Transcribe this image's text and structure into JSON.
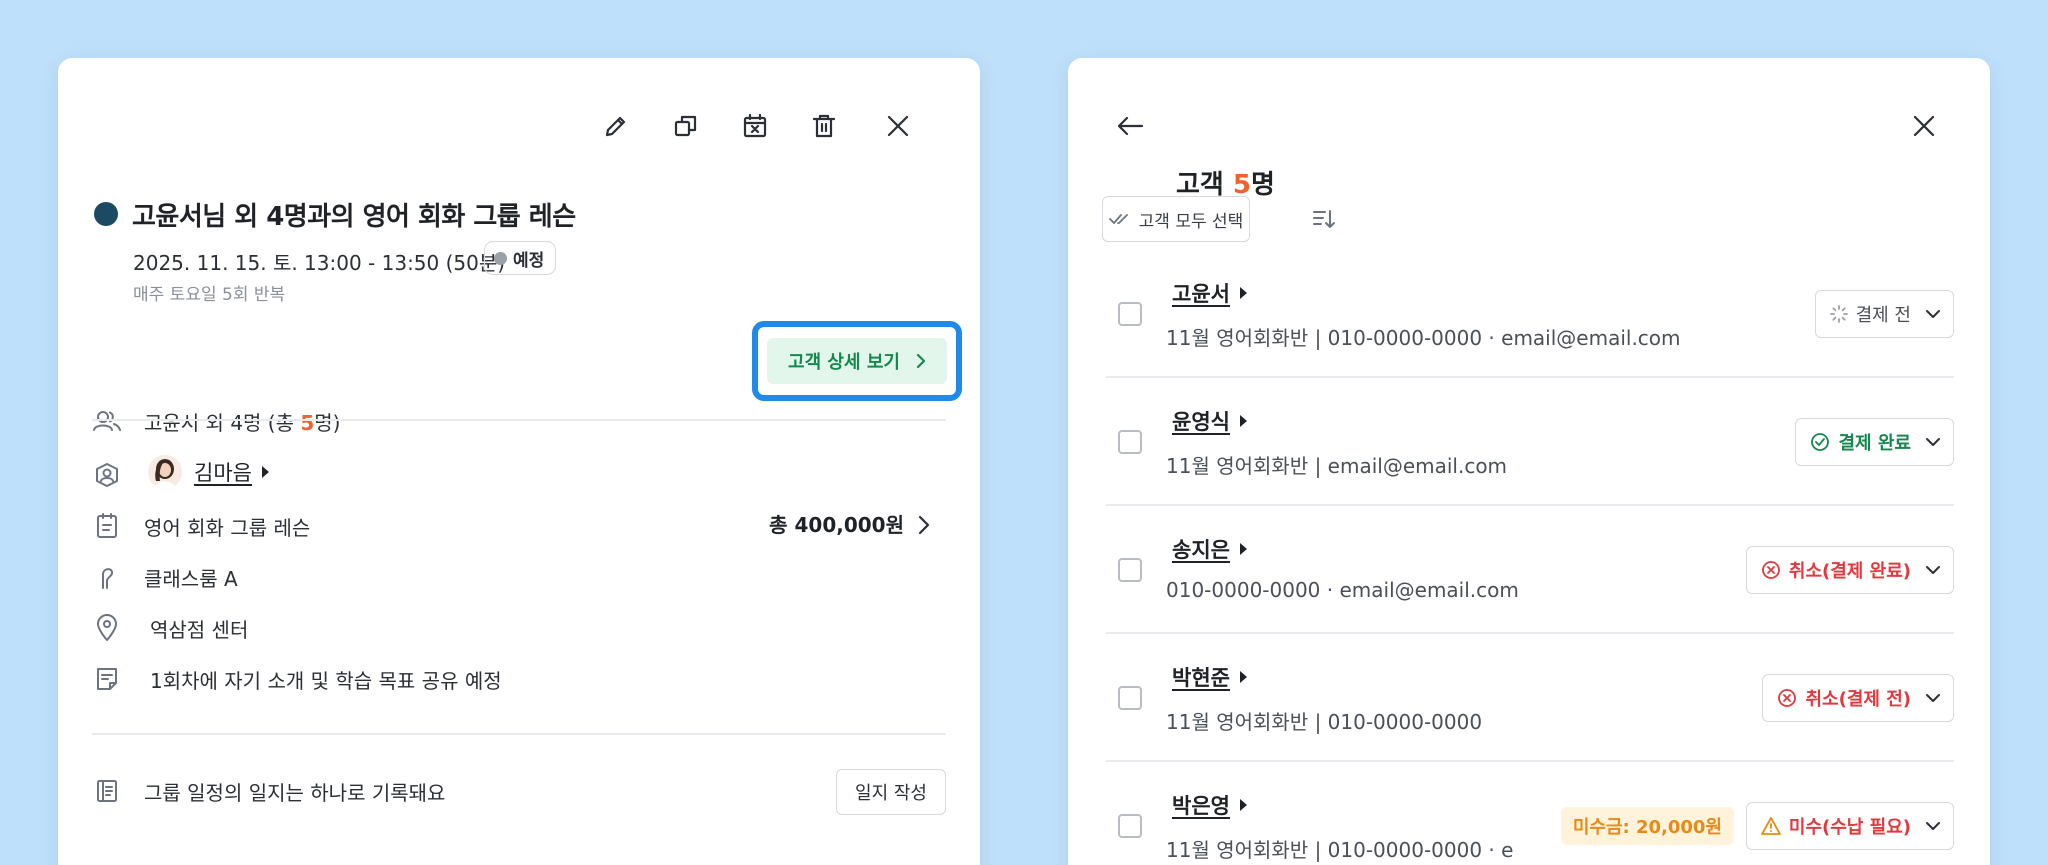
{
  "event": {
    "title": "고윤서님 외 4명과의 영어 회화 그룹 레슨",
    "datetime": "2025. 11. 15. 토. 13:00 - 13:50 (50분)",
    "status": "예정",
    "repeat": "매주 토요일 5회 반복",
    "attendees_prefix": "고윤서 외 4명 (총 ",
    "attendees_count": "5",
    "attendees_suffix": "명)",
    "detail_button": "고객 상세 보기",
    "teacher_name": "김마음",
    "course_name": "영어 회화 그룹 레슨",
    "price": "총 400,000원",
    "classroom": "클래스룸 A",
    "location": "역삼점 센터",
    "memo": "1회차에 자기 소개 및 학습 목표 공유 예정",
    "journal_note": "그룹 일정의 일지는 하나로 기록돼요",
    "journal_button": "일지 작성"
  },
  "customers_panel": {
    "title_prefix": "고객 ",
    "title_count": "5",
    "title_suffix": "명",
    "select_all": "고객 모두 선택",
    "customers": [
      {
        "name": "고윤서",
        "info": "11월 영어회화반 | 010-0000-0000 · email@email.com",
        "status": "결제 전",
        "status_color": "#4a4f58"
      },
      {
        "name": "윤영식",
        "info": "11월 영어회화반 | email@email.com",
        "status": "결제 완료",
        "status_color": "#15884f"
      },
      {
        "name": "송지은",
        "info": "010-0000-0000 · email@email.com",
        "status": "취소(결제 완료)",
        "status_color": "#e0393e"
      },
      {
        "name": "박현준",
        "info": "11월 영어회화반 | 010-0000-0000",
        "status": "취소(결제 전)",
        "status_color": "#e0393e"
      },
      {
        "name": "박은영",
        "info": "11월 영어회화반 | 010-0000-0000 · e",
        "status": "미수(수납 필요)",
        "status_color": "#e0393e",
        "unpaid": "미수금: 20,000원"
      }
    ]
  },
  "colors": {
    "background": "#bfe0fa",
    "accent_orange": "#f0612e",
    "accent_blue": "#1f8ae8",
    "event_dot": "#1c4a63"
  }
}
